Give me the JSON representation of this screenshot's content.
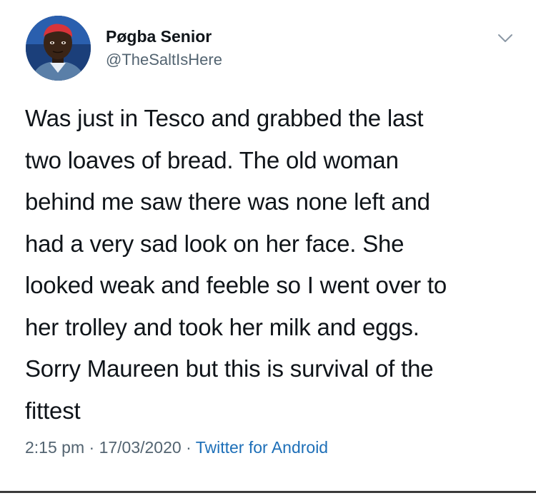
{
  "author": {
    "display_name": "Pøgba Senior",
    "handle": "@TheSaltIsHere",
    "avatar_icon": "profile-photo"
  },
  "more_icon": "chevron-down-icon",
  "tweet": {
    "lines": [
      "Was just in Tesco and grabbed the last",
      "two loaves of bread. The old woman",
      "behind me saw there was none left and",
      "had a very sad look on her face. She",
      "looked weak and feeble so I went over to",
      "her trolley and took her milk and eggs.",
      "Sorry Maureen but this is survival of the",
      "fittest"
    ]
  },
  "meta": {
    "time": "2:15 pm",
    "separator": "·",
    "date": "17/03/2020",
    "source": "Twitter for Android"
  },
  "colors": {
    "text": "#0f1419",
    "secondary": "#536471",
    "link": "#1d6fb8"
  }
}
